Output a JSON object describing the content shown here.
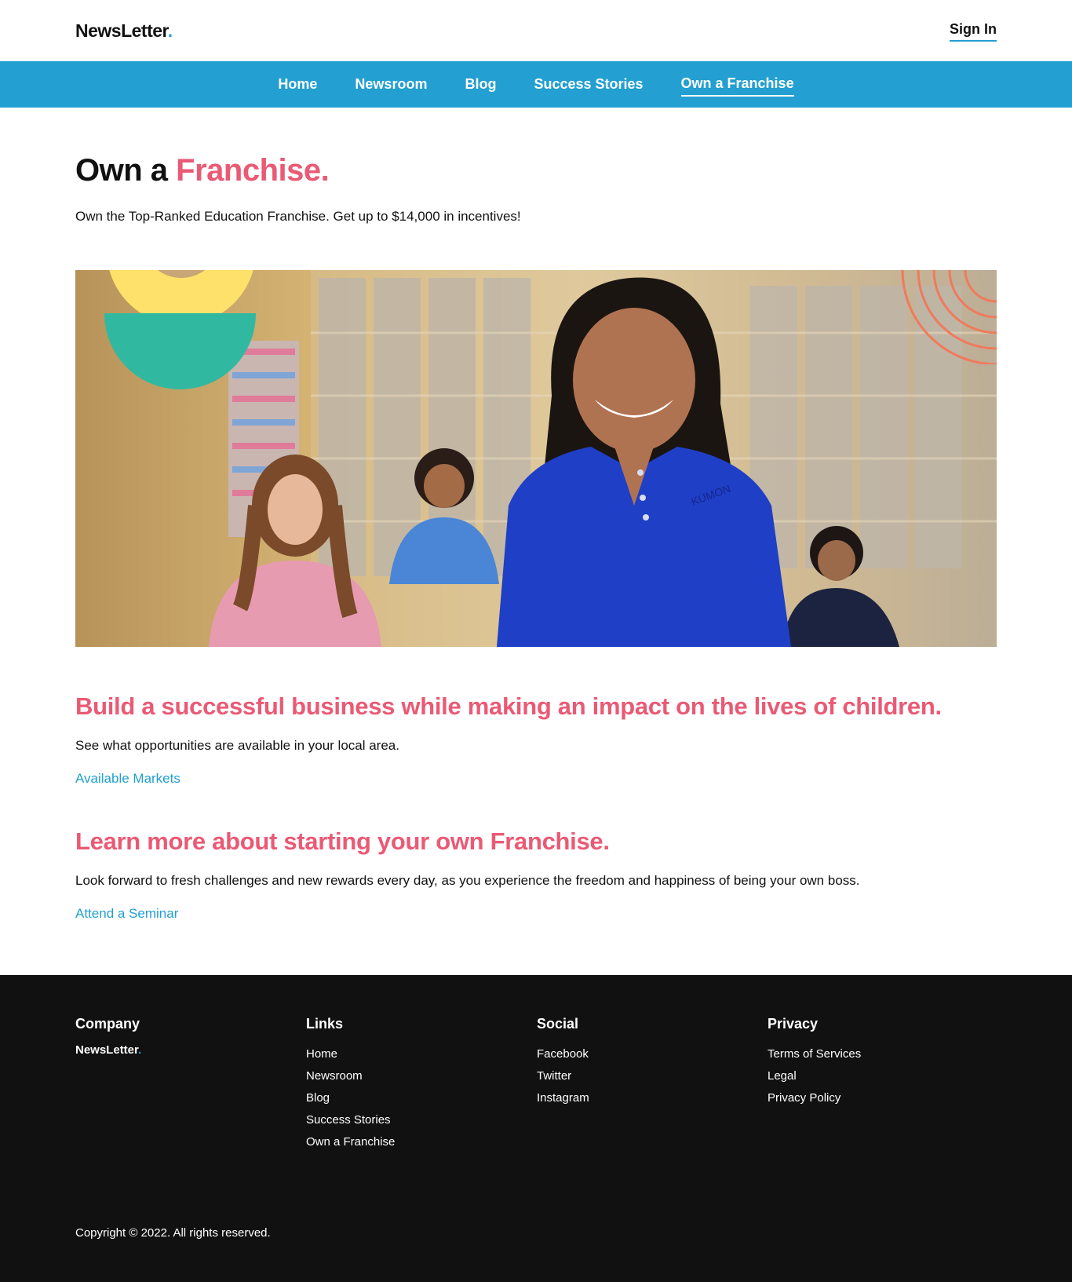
{
  "header": {
    "logo_text": "NewsLetter",
    "logo_dot": ".",
    "sign_in": "Sign In"
  },
  "nav": {
    "items": [
      {
        "label": "Home"
      },
      {
        "label": "Newsroom"
      },
      {
        "label": "Blog"
      },
      {
        "label": "Success Stories"
      },
      {
        "label": "Own a Franchise",
        "active": true
      }
    ]
  },
  "page": {
    "title_plain": "Own a ",
    "title_accent": "Franchise.",
    "subtitle": "Own the Top-Ranked Education Franchise. Get up to $14,000 in incentives!"
  },
  "sections": [
    {
      "title": "Build a successful business while making an impact on the lives of children.",
      "text": "See what opportunities are available in your local area.",
      "link": "Available Markets"
    },
    {
      "title": "Learn more about starting your own Franchise.",
      "text": "Look forward to fresh challenges and new rewards every day, as you experience the freedom and happiness of being your own boss.",
      "link": "Attend a Seminar"
    }
  ],
  "footer": {
    "company": {
      "heading": "Company",
      "logo_text": "NewsLetter",
      "logo_dot": "."
    },
    "links": {
      "heading": "Links",
      "items": [
        "Home",
        "Newsroom",
        "Blog",
        "Success Stories",
        "Own a Franchise"
      ]
    },
    "social": {
      "heading": "Social",
      "items": [
        "Facebook",
        "Twitter",
        "Instagram"
      ]
    },
    "privacy": {
      "heading": "Privacy",
      "items": [
        "Terms of Services",
        "Legal",
        "Privacy Policy"
      ]
    },
    "copyright": "Copyright © 2022. All rights reserved."
  },
  "colors": {
    "brand_blue": "#239fd1",
    "accent_pink": "#ea5a75",
    "footer_bg": "#111111"
  }
}
